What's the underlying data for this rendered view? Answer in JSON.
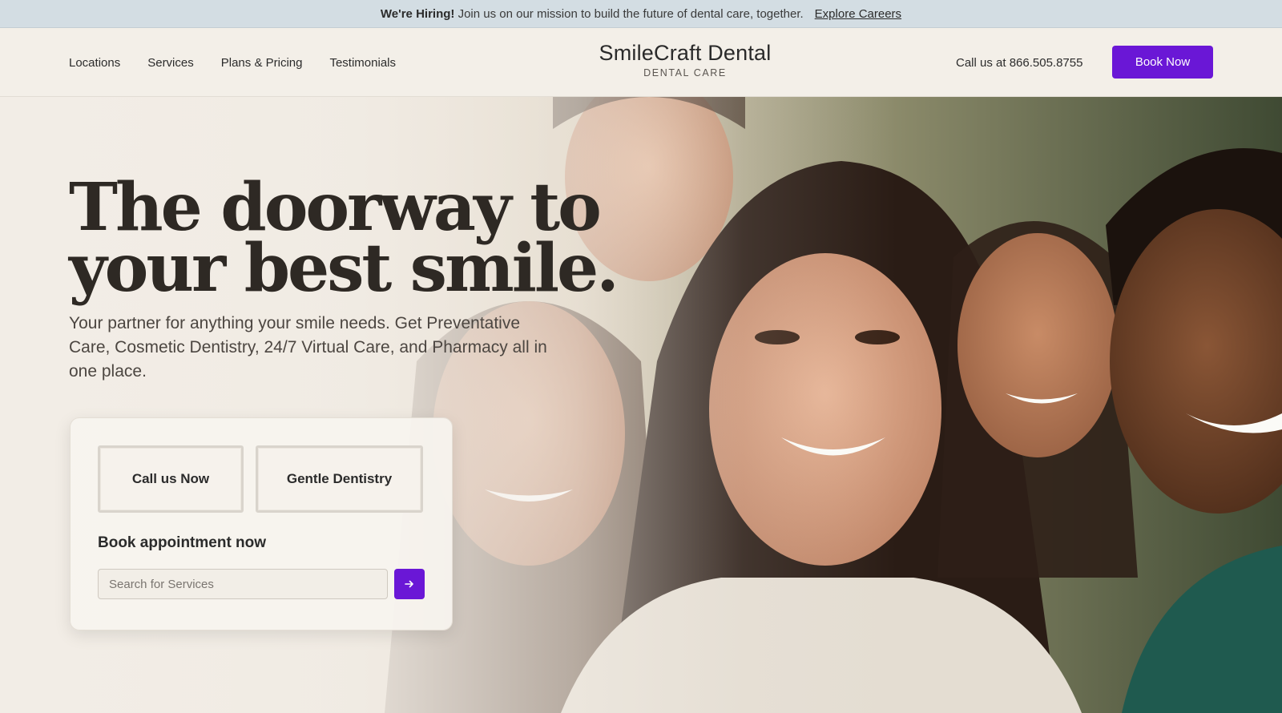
{
  "announcement": {
    "lead": "We're Hiring!",
    "text": "Join us on our mission to build the future of dental care, together.",
    "link": "Explore Careers"
  },
  "nav": {
    "items": [
      {
        "label": "Locations"
      },
      {
        "label": "Services"
      },
      {
        "label": "Plans & Pricing"
      },
      {
        "label": "Testimonials"
      }
    ]
  },
  "brand": {
    "name": "SmileCraft Dental",
    "tagline": "DENTAL CARE"
  },
  "header": {
    "phone": "Call us at 866.505.8755",
    "cta": "Book Now"
  },
  "hero": {
    "headline": "The doorway to your best smile.",
    "subcopy": "Your partner for anything your smile needs. Get Preventative Care, Cosmetic Dentistry, 24/7 Virtual Care, and Pharmacy all in one place.",
    "photo_icon": "group-of-smiling-people-photo"
  },
  "card": {
    "chips": [
      {
        "label": "Call us Now"
      },
      {
        "label": "Gentle Dentistry"
      }
    ],
    "title": "Book appointment now",
    "search_placeholder": "Search for Services",
    "submit_icon": "arrow-right-icon"
  },
  "colors": {
    "accent": "#6a17d6",
    "announcement_bg": "#d3dde3",
    "page_bg": "#f2ede6"
  }
}
